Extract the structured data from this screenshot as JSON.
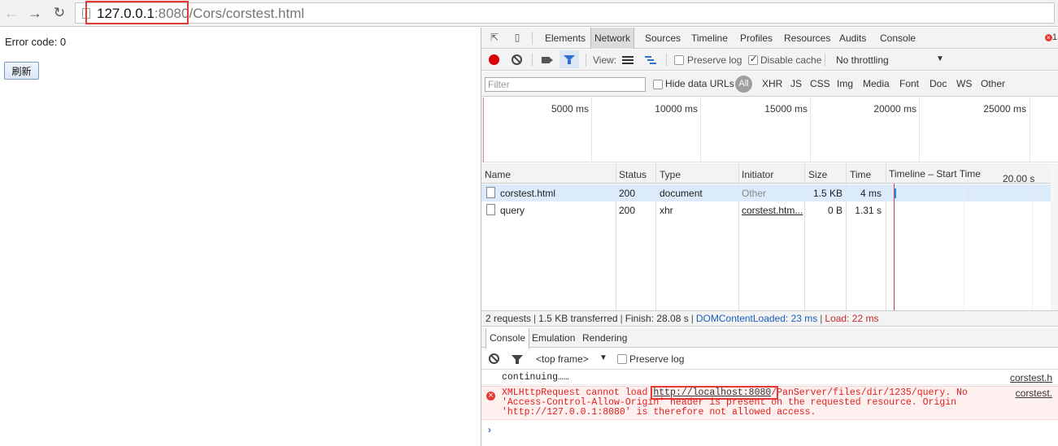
{
  "browser": {
    "url_host": "127.0.0.1",
    "url_port": ":8080",
    "url_path": "/Cors/corstest.html"
  },
  "page": {
    "error_code": "Error code: 0",
    "refresh_button": "刷新"
  },
  "devtools": {
    "tabs": [
      "Elements",
      "Network",
      "Sources",
      "Timeline",
      "Profiles",
      "Resources",
      "Audits",
      "Console"
    ],
    "active_tab": "Network",
    "error_count": "1",
    "toolbar": {
      "view_label": "View:",
      "preserve_log": "Preserve log",
      "disable_cache": "Disable cache",
      "throttling": "No throttling"
    },
    "filter": {
      "placeholder": "Filter",
      "hide_data_urls": "Hide data URLs",
      "types": [
        "All",
        "XHR",
        "JS",
        "CSS",
        "Img",
        "Media",
        "Font",
        "Doc",
        "WS",
        "Other"
      ]
    },
    "overview_ticks": [
      "5000 ms",
      "10000 ms",
      "15000 ms",
      "20000 ms",
      "25000 ms"
    ],
    "table": {
      "headers": [
        "Name",
        "Status",
        "Type",
        "Initiator",
        "Size",
        "Time",
        "Timeline – Start Time"
      ],
      "timeline_scale": "20.00 s",
      "rows": [
        {
          "name": "corstest.html",
          "status": "200",
          "type": "document",
          "initiator": "Other",
          "size": "1.5 KB",
          "time": "4 ms"
        },
        {
          "name": "query",
          "status": "200",
          "type": "xhr",
          "initiator": "corstest.htm...",
          "size": "0 B",
          "time": "1.31 s"
        }
      ]
    },
    "summary": {
      "requests": "2 requests",
      "transferred": "1.5 KB transferred",
      "finish": "Finish: 28.08 s",
      "dom_loaded": "DOMContentLoaded: 23 ms",
      "load": "Load: 22 ms"
    },
    "console_tabs": [
      "Console",
      "Emulation",
      "Rendering"
    ],
    "console_toolbar": {
      "frame": "<top frame>",
      "preserve_log": "Preserve log"
    },
    "console": {
      "log_message": "continuing……",
      "log_source": "corstest.h",
      "error_line1_pre": "XMLHttpRequest cannot load ",
      "error_line1_url": "http://localhost:8080",
      "error_line1_post": "/PanServer/files/dir/1235/query. No",
      "error_line2": "'Access-Control-Allow-Origin' header is present on the requested resource. Origin",
      "error_line3": "'http://127.0.0.1:8080' is therefore not allowed access.",
      "error_source": "corstest.",
      "prompt": "›"
    }
  },
  "colors": {
    "highlight": "#e53935",
    "error_text": "#e0201c",
    "link_blue": "#1a5fbf"
  }
}
